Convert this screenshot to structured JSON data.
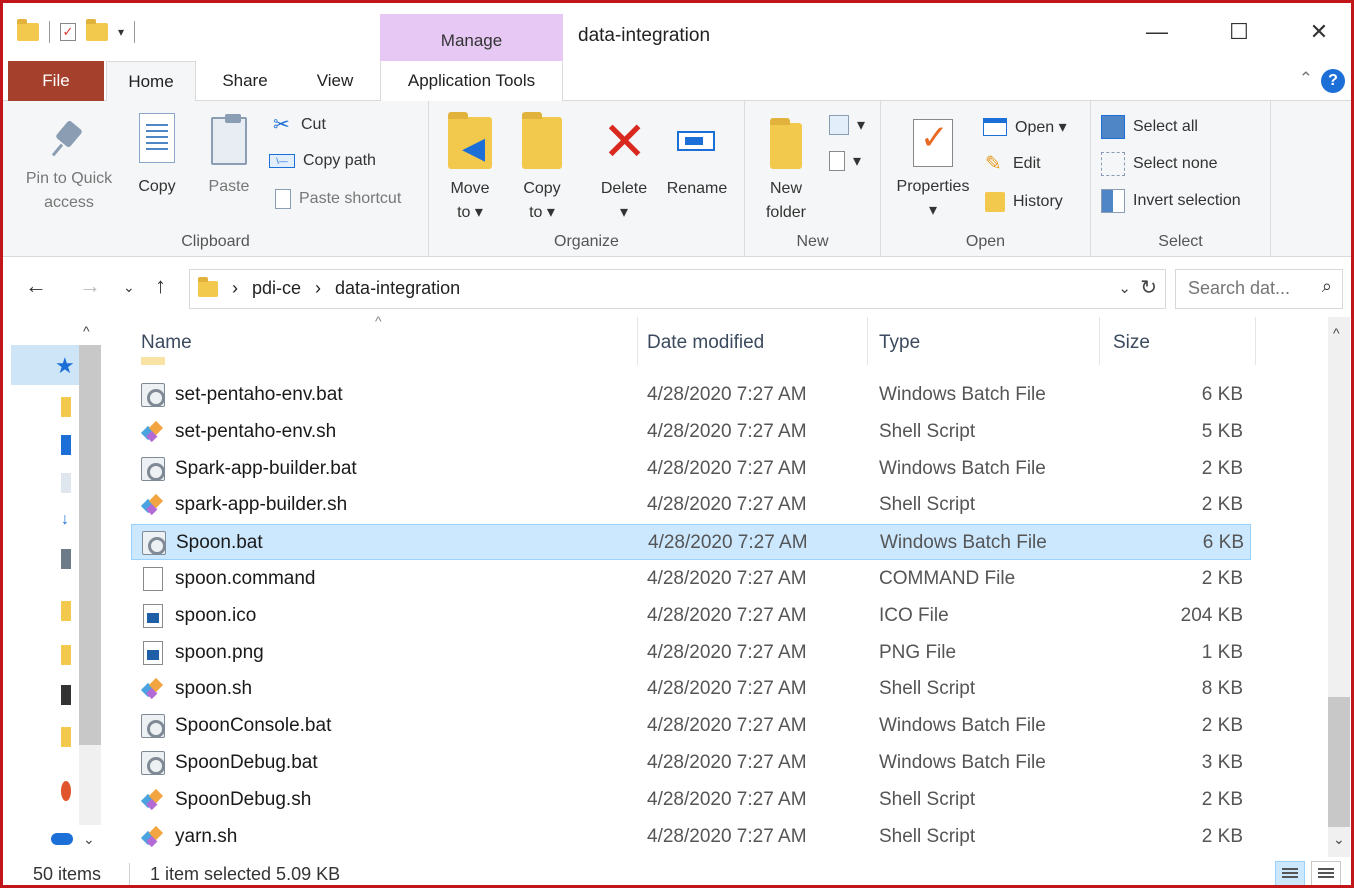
{
  "window": {
    "title": "data-integration",
    "context_tab": "Manage",
    "minimize": "—",
    "maximize": "☐",
    "close": "✕"
  },
  "tabs": [
    "File",
    "Home",
    "Share",
    "View",
    "Application Tools"
  ],
  "ribbon": {
    "clipboard": {
      "label": "Clipboard",
      "pin": "Pin to Quick access",
      "pin_line1": "Pin to Quick",
      "pin_line2": "access",
      "copy": "Copy",
      "paste": "Paste",
      "cut": "Cut",
      "copy_path": "Copy path",
      "paste_shortcut": "Paste shortcut"
    },
    "organize": {
      "label": "Organize",
      "move_to": "Move",
      "move_to_2": "to ▾",
      "copy_to": "Copy",
      "copy_to_2": "to ▾",
      "delete": "Delete",
      "delete_dd": "▾",
      "rename": "Rename"
    },
    "new": {
      "label": "New",
      "new_folder": "New",
      "new_folder_2": "folder"
    },
    "open": {
      "label": "Open",
      "properties": "Properties",
      "properties_dd": "▾",
      "open": "Open ▾",
      "edit": "Edit",
      "history": "History"
    },
    "select": {
      "label": "Select",
      "select_all": "Select all",
      "select_none": "Select none",
      "invert": "Invert selection"
    }
  },
  "address": {
    "crumbs": [
      "pdi-ce",
      "data-integration"
    ],
    "search_placeholder": "Search dat..."
  },
  "columns": {
    "name": "Name",
    "date": "Date modified",
    "type": "Type",
    "size": "Size"
  },
  "files": [
    {
      "name": "set-pentaho-env.bat",
      "date": "4/28/2020 7:27 AM",
      "type": "Windows Batch File",
      "size": "6 KB",
      "icon": "bat"
    },
    {
      "name": "set-pentaho-env.sh",
      "date": "4/28/2020 7:27 AM",
      "type": "Shell Script",
      "size": "5 KB",
      "icon": "sh"
    },
    {
      "name": "Spark-app-builder.bat",
      "date": "4/28/2020 7:27 AM",
      "type": "Windows Batch File",
      "size": "2 KB",
      "icon": "bat"
    },
    {
      "name": "spark-app-builder.sh",
      "date": "4/28/2020 7:27 AM",
      "type": "Shell Script",
      "size": "2 KB",
      "icon": "sh"
    },
    {
      "name": "Spoon.bat",
      "date": "4/28/2020 7:27 AM",
      "type": "Windows Batch File",
      "size": "6 KB",
      "icon": "bat",
      "selected": true
    },
    {
      "name": "spoon.command",
      "date": "4/28/2020 7:27 AM",
      "type": "COMMAND File",
      "size": "2 KB",
      "icon": "blank"
    },
    {
      "name": "spoon.ico",
      "date": "4/28/2020 7:27 AM",
      "type": "ICO File",
      "size": "204 KB",
      "icon": "img"
    },
    {
      "name": "spoon.png",
      "date": "4/28/2020 7:27 AM",
      "type": "PNG File",
      "size": "1 KB",
      "icon": "img"
    },
    {
      "name": "spoon.sh",
      "date": "4/28/2020 7:27 AM",
      "type": "Shell Script",
      "size": "8 KB",
      "icon": "sh"
    },
    {
      "name": "SpoonConsole.bat",
      "date": "4/28/2020 7:27 AM",
      "type": "Windows Batch File",
      "size": "2 KB",
      "icon": "bat"
    },
    {
      "name": "SpoonDebug.bat",
      "date": "4/28/2020 7:27 AM",
      "type": "Windows Batch File",
      "size": "3 KB",
      "icon": "bat"
    },
    {
      "name": "SpoonDebug.sh",
      "date": "4/28/2020 7:27 AM",
      "type": "Shell Script",
      "size": "2 KB",
      "icon": "sh"
    },
    {
      "name": "yarn.sh",
      "date": "4/28/2020 7:27 AM",
      "type": "Shell Script",
      "size": "2 KB",
      "icon": "sh"
    }
  ],
  "status": {
    "count": "50 items",
    "selection": "1 item selected  5.09 KB"
  },
  "colors": {
    "file_tab": "#a5402c",
    "manage_tab": "#e7c8f5",
    "selection": "#cce8ff",
    "frame": "#c0161a"
  }
}
